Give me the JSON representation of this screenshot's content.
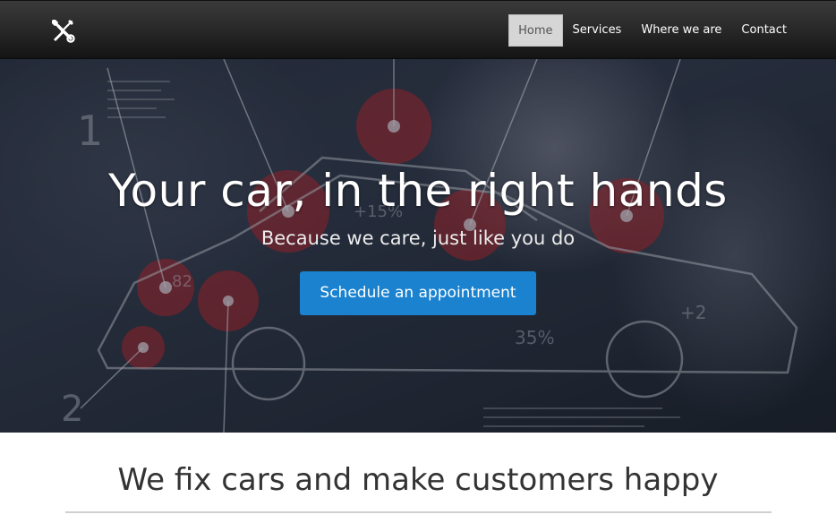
{
  "nav": {
    "brand_icon": "wrench-screwdriver-icon",
    "items": [
      {
        "label": "Home",
        "active": true
      },
      {
        "label": "Services",
        "active": false
      },
      {
        "label": "Where we are",
        "active": false
      },
      {
        "label": "Contact",
        "active": false
      }
    ]
  },
  "hero": {
    "title": "Your car, in the right hands",
    "subtitle": "Because we care, just like you do",
    "cta_label": "Schedule an appointment",
    "overlay_numbers": [
      "1",
      "+15%",
      "82",
      "35%",
      "+2",
      "2"
    ],
    "cta_color": "#1a82cf"
  },
  "section": {
    "title": "We fix cars and make customers happy"
  }
}
